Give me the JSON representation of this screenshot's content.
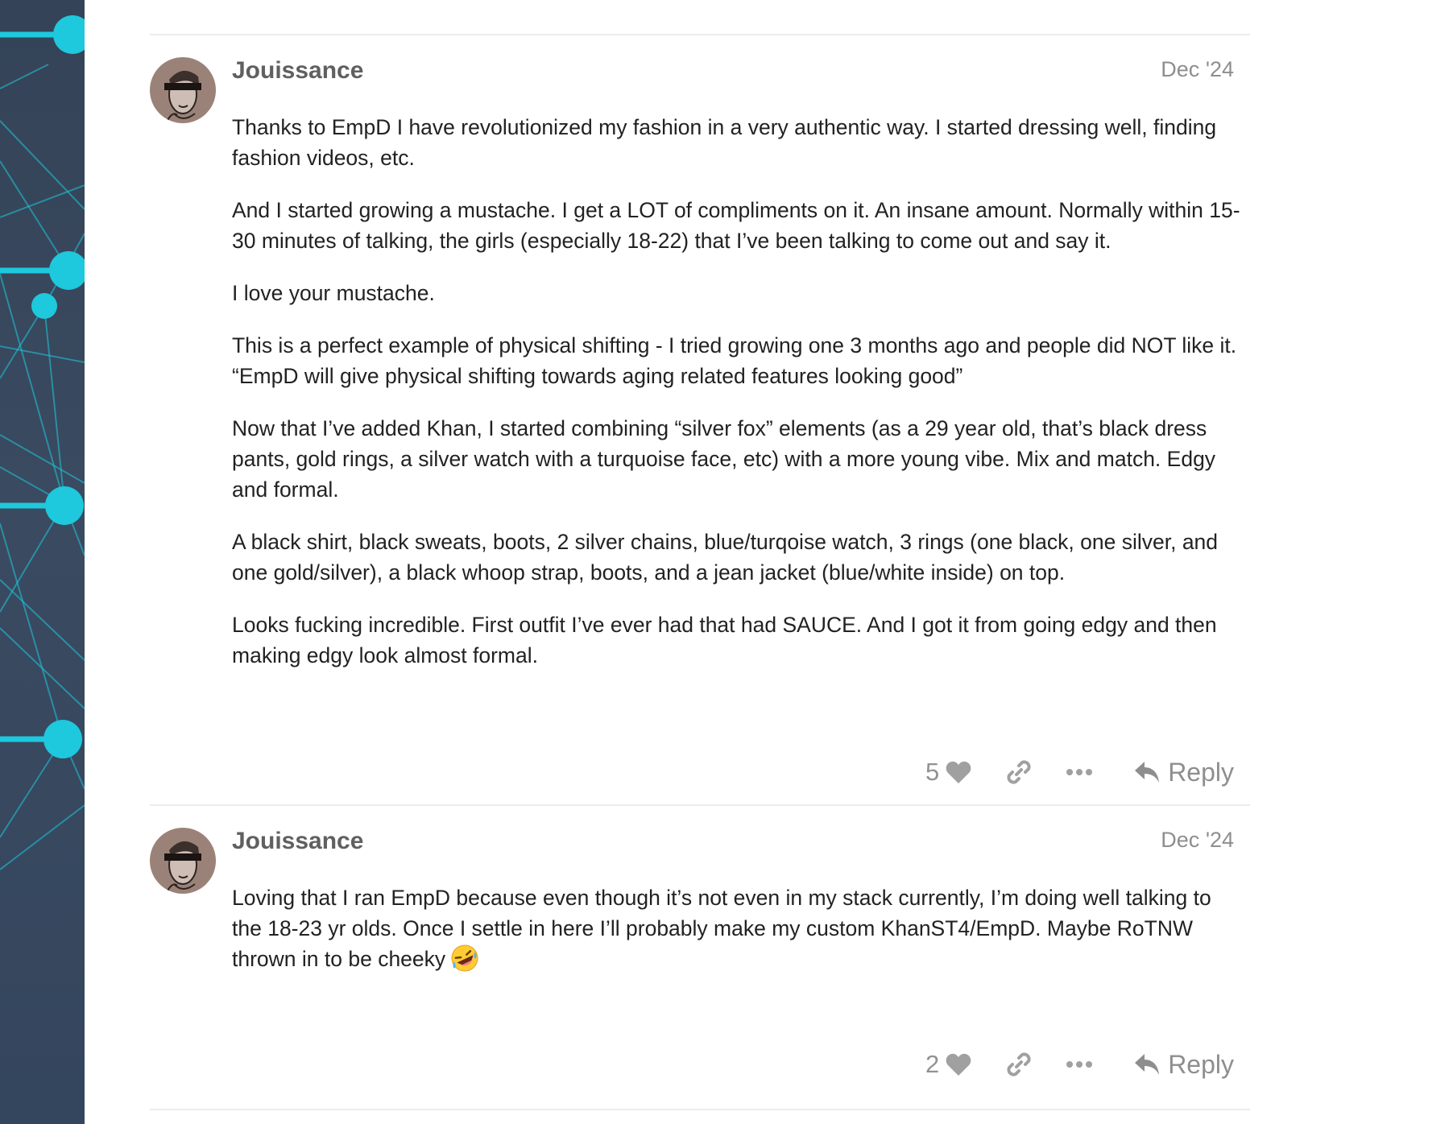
{
  "posts": [
    {
      "username": "Jouissance",
      "date": "Dec '24",
      "avatar_icon": "sketch-face-avatar",
      "paragraphs": [
        "Thanks to EmpD I have revolutionized my fashion in a very authentic way. I started dressing well, finding fashion videos, etc.",
        "And I started growing a mustache. I get a LOT of compliments on it. An insane amount. Normally within 15-30 minutes of talking, the girls (especially 18-22) that I’ve been talking to come out and say it.",
        "I love your mustache.",
        "This is a perfect example of physical shifting - I tried growing one 3 months ago and people did NOT like it. “EmpD will give physical shifting towards aging related features looking good”",
        "Now that I’ve added Khan, I started combining “silver fox” elements (as a 29 year old, that’s black dress pants, gold rings, a silver watch with a turquoise face, etc) with a more young vibe. Mix and match. Edgy and formal.",
        "A black shirt, black sweats, boots, 2 silver chains, blue/turqoise watch, 3 rings (one black, one silver, and one gold/silver), a black whoop strap, boots, and a jean jacket (blue/white inside) on top.",
        "Looks fucking incredible. First outfit I’ve ever had that had SAUCE. And I got it from going edgy and then making edgy look almost formal."
      ],
      "likes": "5",
      "reply_label": "Reply"
    },
    {
      "username": "Jouissance",
      "date": "Dec '24",
      "avatar_icon": "sketch-face-avatar",
      "paragraphs": [
        "Loving that I ran EmpD because even though it’s not even in my stack currently, I’m doing well talking to the 18-23 yr olds. Once I settle in here I’ll probably make my custom KhanST4/EmpD. Maybe RoTNW thrown in to be cheeky"
      ],
      "emoji": "rolling-on-floor-laughing-emoji",
      "likes": "2",
      "reply_label": "Reply"
    }
  ],
  "icons": {
    "like": "heart-icon",
    "share": "link-icon",
    "more": "ellipsis-icon",
    "reply": "reply-arrow-icon"
  },
  "colors": {
    "sidebar_bg": "#344357",
    "network_accent": "#1ec8dd",
    "username": "#606060",
    "meta_gray": "#8e8e8e",
    "body_text": "#222222",
    "divider": "#ececec"
  }
}
